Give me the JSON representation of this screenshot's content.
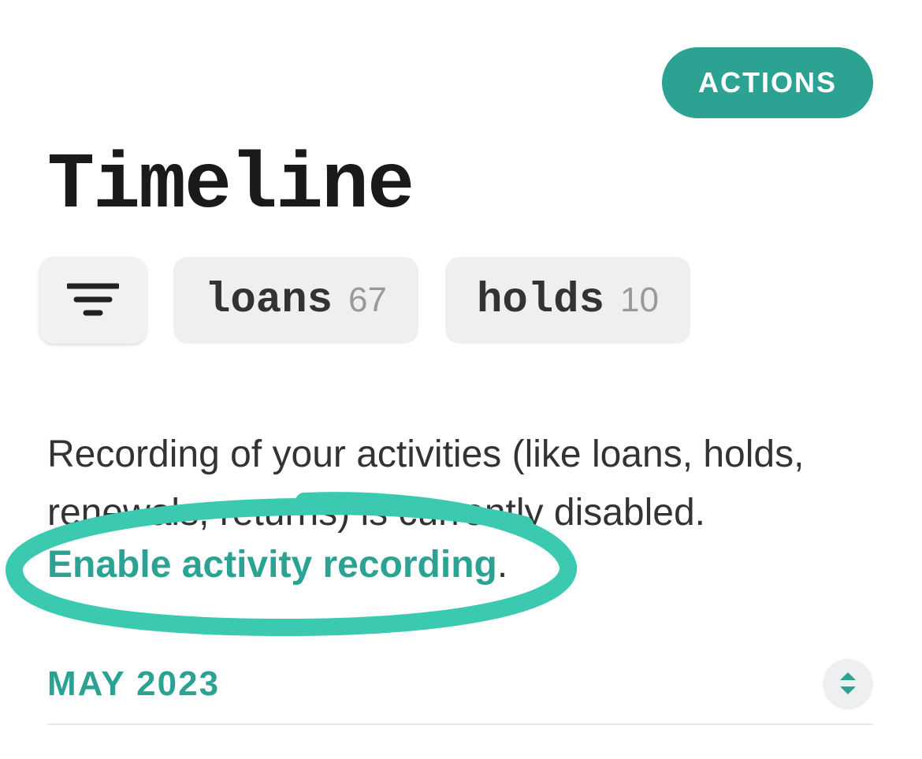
{
  "header": {
    "actions_label": "ACTIONS"
  },
  "page": {
    "title": "Timeline"
  },
  "filters": {
    "loans": {
      "label": "loans",
      "count": "67"
    },
    "holds": {
      "label": "holds",
      "count": "10"
    }
  },
  "info": {
    "message": "Recording of your activities (like loans, holds, renewals, returns) is currently disabled.",
    "enable_link": "Enable activity recording",
    "period": "."
  },
  "section": {
    "month_label": "MAY 2023"
  },
  "colors": {
    "accent": "#2ca392",
    "chip_bg": "#eeeff1"
  }
}
